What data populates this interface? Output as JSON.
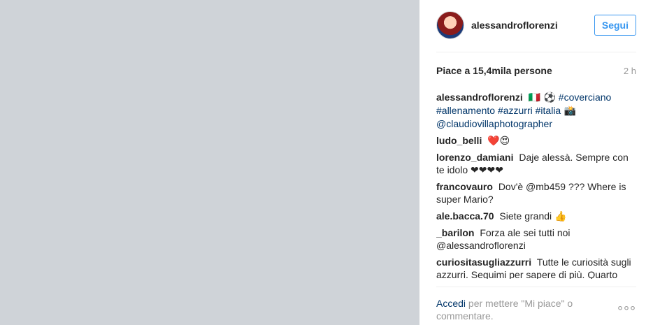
{
  "header": {
    "username": "alessandroflorenzi",
    "follow_label": "Segui"
  },
  "stats": {
    "likes_text": "Piace a 15,4mila persone",
    "time_text": "2 h"
  },
  "caption": {
    "user": "alessandroflorenzi",
    "text_parts": [
      {
        "type": "emoji",
        "text": "🇮🇹"
      },
      {
        "type": "emoji",
        "text": "⚽"
      },
      {
        "type": "tag",
        "text": "#coverciano"
      },
      {
        "type": "tag",
        "text": "#allenamento"
      },
      {
        "type": "tag",
        "text": "#azzurri"
      },
      {
        "type": "tag",
        "text": "#italia"
      },
      {
        "type": "emoji",
        "text": "📸"
      },
      {
        "type": "tag",
        "text": "@claudiovillaphotographer"
      }
    ]
  },
  "comments": [
    {
      "user": "ludo_belli",
      "text": "❤️😍"
    },
    {
      "user": "lorenzo_damiani",
      "text": "Daje alessà. Sempre con te idolo ❤❤❤❤"
    },
    {
      "user": "francovauro",
      "text": "Dov'è @mb459 ??? Where is super Mario?"
    },
    {
      "user": "ale.bacca.70",
      "text": "Siete grandi 👍"
    },
    {
      "user": "_barilon",
      "text": "Forza ale sei tutti noi @alessandroflorenzi"
    },
    {
      "user": "curiositasugliazzurri",
      "text": "Tutte le curiosità sugli azzurri. Seguimi per sapere di più. Quarto"
    }
  ],
  "footer": {
    "login_link": "Accedi",
    "login_text": " per mettere \"Mi piace\" o commentare.",
    "more_icon": "ellipsis-icon"
  }
}
